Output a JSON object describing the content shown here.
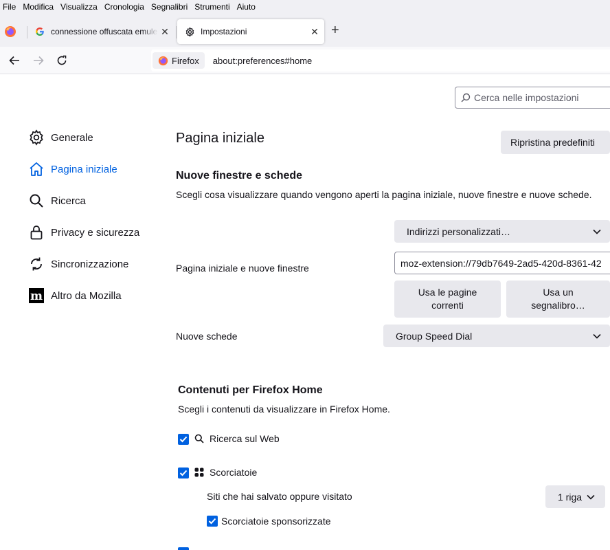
{
  "menu": [
    "File",
    "Modifica",
    "Visualizza",
    "Cronologia",
    "Segnalibri",
    "Strumenti",
    "Aiuto"
  ],
  "tabs": [
    {
      "title": "connessione offuscata emule com",
      "icon": "google-icon"
    },
    {
      "title": "Impostazioni",
      "icon": "gear-icon"
    }
  ],
  "urlbar": {
    "identity": "Firefox",
    "url": "about:preferences#home"
  },
  "search": {
    "placeholder": "Cerca nelle impostazioni"
  },
  "sidebar": {
    "items": [
      {
        "label": "Generale",
        "icon": "gear-icon"
      },
      {
        "label": "Pagina iniziale",
        "icon": "home-icon",
        "selected": true
      },
      {
        "label": "Ricerca",
        "icon": "search-icon"
      },
      {
        "label": "Privacy e sicurezza",
        "icon": "lock-icon"
      },
      {
        "label": "Sincronizzazione",
        "icon": "sync-icon"
      },
      {
        "label": "Altro da Mozilla",
        "icon": "mozilla-icon"
      }
    ]
  },
  "main": {
    "title": "Pagina iniziale",
    "restore_button": "Ripristina predefiniti",
    "section1": {
      "heading": "Nuove finestre e schede",
      "description": "Scegli cosa visualizzare quando vengono aperti la pagina iniziale, nuove finestre e nuove schede.",
      "homepage_select": "Indirizzi personalizzati…",
      "homepage_label": "Pagina iniziale e nuove finestre",
      "homepage_url": "moz-extension://79db7649-2ad5-420d-8361-42",
      "use_current_line1": "Usa le pagine",
      "use_current_line2": "correnti",
      "use_bookmark_line1": "Usa un",
      "use_bookmark_line2": "segnalibro…",
      "newtabs_label": "Nuove schede",
      "newtabs_select": "Group Speed Dial"
    },
    "section2": {
      "heading": "Contenuti per Firefox Home",
      "description": "Scegli i contenuti da visualizzare in Firefox Home.",
      "web_search": "Ricerca sul Web",
      "shortcuts": "Scorciatoie",
      "shortcuts_desc": "Siti che hai salvato oppure visitato",
      "rows_select": "1 riga",
      "sponsored": "Scorciatoie sponsorizzate"
    }
  },
  "colors": {
    "accent": "#0061e0",
    "button_bg": "#e8e8ed",
    "chrome_bg": "#f0f0f4"
  }
}
